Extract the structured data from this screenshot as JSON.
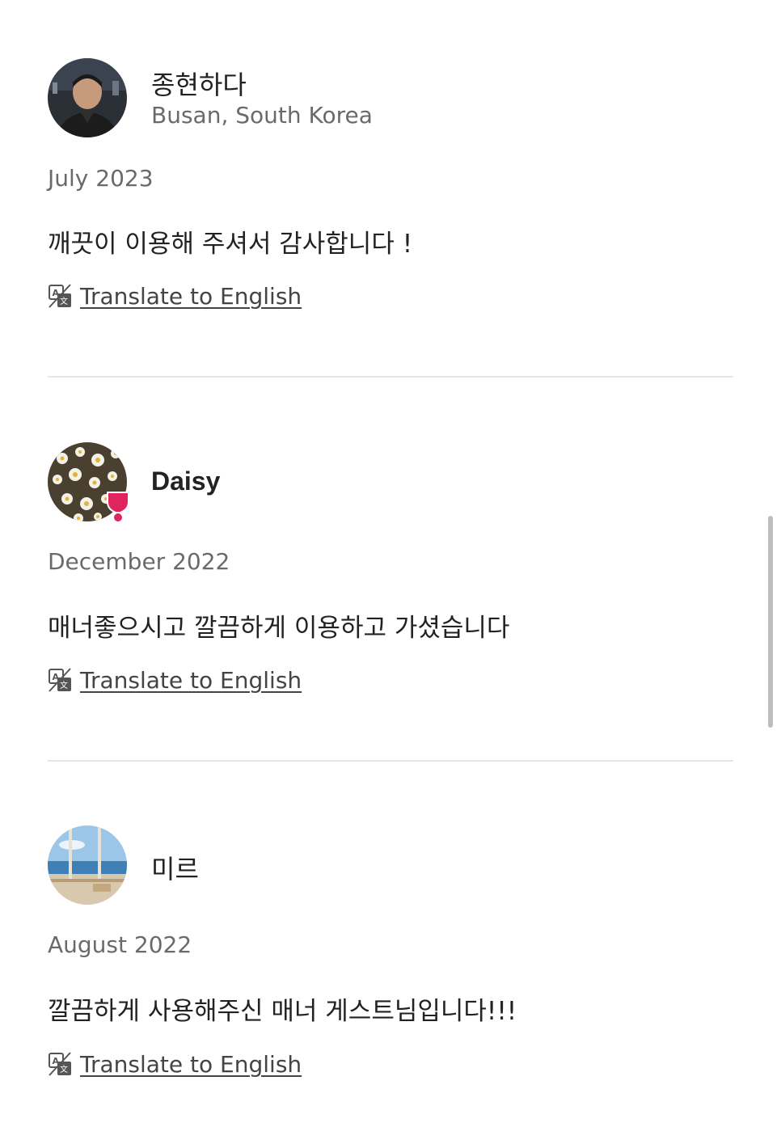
{
  "reviews": [
    {
      "name": "종현하다",
      "location": "Busan, South Korea",
      "date": "July 2023",
      "text": "깨끗이 이용해 주셔서 감사합니다 !",
      "translate_label": "Translate to English"
    },
    {
      "name": "Daisy",
      "location": "",
      "date": "December 2022",
      "text": "매너좋으시고 깔끔하게 이용하고 가셨습니다",
      "translate_label": "Translate to English",
      "badge": "superhost-badge",
      "badge_color": "#e0245e"
    },
    {
      "name": "미르",
      "location": "",
      "date": "August 2022",
      "text": "깔끔하게 사용해주신 매너 게스트님입니다!!!",
      "translate_label": "Translate to English"
    }
  ],
  "icons": {
    "translate": "translate-icon"
  }
}
